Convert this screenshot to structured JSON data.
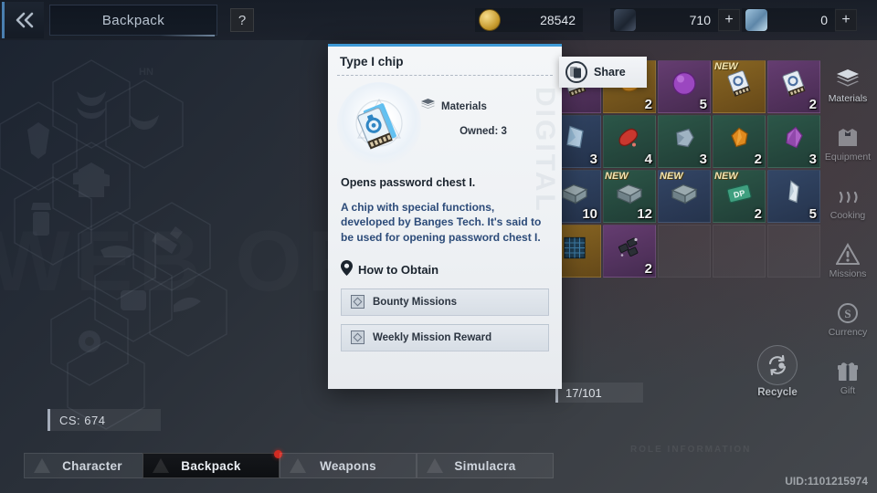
{
  "topbar": {
    "back_icon": "double-chevron-left-icon",
    "title": "Backpack",
    "help_label": "?",
    "currencies": [
      {
        "icon": "gold-coin-icon",
        "value": "28542",
        "has_plus": false,
        "plus_label": "+"
      },
      {
        "icon": "dark-crystal-icon",
        "value": "710",
        "has_plus": true,
        "plus_label": "+"
      },
      {
        "icon": "blue-crystal-icon",
        "value": "0",
        "has_plus": true,
        "plus_label": "+"
      }
    ]
  },
  "character_panel": {
    "watermark": "WEB OF",
    "cs_label": "CS:  674"
  },
  "share": {
    "icon": "share-icon",
    "label": "Share"
  },
  "dialog": {
    "title": "Type I chip",
    "category_icon": "layers-icon",
    "category": "Materials",
    "owned": "Owned: 3",
    "item_icon": "chip-card-icon",
    "effect": "Opens password chest I.",
    "description": "A chip with special functions, developed by Banges Tech. It's said to be used for opening password chest I.",
    "obtain_icon": "map-pin-icon",
    "obtain_title": "How to Obtain",
    "obtain_sources": [
      {
        "icon": "mission-scroll-icon",
        "label": "Bounty Missions"
      },
      {
        "icon": "mission-scroll-icon",
        "label": "Weekly Mission Reward"
      }
    ],
    "watermark": "DIGITAL"
  },
  "inventory": {
    "page_counter": "17/101",
    "cells": [
      {
        "row": 0,
        "col": 0,
        "rarity": "purple",
        "count": "",
        "new": false,
        "glyph": "chip-card-icon"
      },
      {
        "row": 0,
        "col": 1,
        "rarity": "gold",
        "count": "2",
        "new": false,
        "glyph": "amber-lump-icon"
      },
      {
        "row": 0,
        "col": 2,
        "rarity": "purple",
        "count": "5",
        "new": false,
        "glyph": "purple-orb-icon"
      },
      {
        "row": 0,
        "col": 3,
        "rarity": "gold",
        "count": "",
        "new": true,
        "glyph": "chip-card-icon"
      },
      {
        "row": 0,
        "col": 4,
        "rarity": "purple",
        "count": "2",
        "new": false,
        "glyph": "chip-card-icon"
      },
      {
        "row": 1,
        "col": 0,
        "rarity": "blue",
        "count": "3",
        "new": false,
        "glyph": "blue-shard-icon"
      },
      {
        "row": 1,
        "col": 1,
        "rarity": "green",
        "count": "4",
        "new": false,
        "glyph": "red-gem-icon"
      },
      {
        "row": 1,
        "col": 2,
        "rarity": "green",
        "count": "3",
        "new": false,
        "glyph": "grey-stone-icon"
      },
      {
        "row": 1,
        "col": 3,
        "rarity": "green",
        "count": "2",
        "new": false,
        "glyph": "orange-gem-icon"
      },
      {
        "row": 1,
        "col": 4,
        "rarity": "green",
        "count": "3",
        "new": false,
        "glyph": "violet-gem-icon"
      },
      {
        "row": 2,
        "col": 0,
        "rarity": "blue",
        "count": "10",
        "new": false,
        "glyph": "crate-icon"
      },
      {
        "row": 2,
        "col": 1,
        "rarity": "green",
        "count": "12",
        "new": true,
        "glyph": "crate-icon"
      },
      {
        "row": 2,
        "col": 2,
        "rarity": "blue",
        "count": "",
        "new": true,
        "glyph": "crate-icon"
      },
      {
        "row": 2,
        "col": 3,
        "rarity": "green",
        "count": "2",
        "new": true,
        "glyph": "dp-card-icon"
      },
      {
        "row": 2,
        "col": 4,
        "rarity": "blue",
        "count": "5",
        "new": false,
        "glyph": "white-crystal-icon"
      },
      {
        "row": 3,
        "col": 0,
        "rarity": "gold",
        "count": "",
        "new": false,
        "glyph": "grid-cube-icon"
      },
      {
        "row": 3,
        "col": 1,
        "rarity": "purple",
        "count": "2",
        "new": false,
        "glyph": "black-chips-icon"
      },
      {
        "row": 3,
        "col": 2,
        "rarity": "empty",
        "count": "",
        "new": false,
        "glyph": ""
      },
      {
        "row": 3,
        "col": 3,
        "rarity": "empty",
        "count": "",
        "new": false,
        "glyph": ""
      },
      {
        "row": 3,
        "col": 4,
        "rarity": "empty",
        "count": "",
        "new": false,
        "glyph": ""
      }
    ]
  },
  "sidebar": {
    "items": [
      {
        "icon": "layers-icon",
        "label": "Materials",
        "active": true
      },
      {
        "icon": "armor-icon",
        "label": "Equipment",
        "active": false
      },
      {
        "icon": "cooking-icon",
        "label": "Cooking",
        "active": false
      },
      {
        "icon": "mission-icon",
        "label": "Missions",
        "active": false
      },
      {
        "icon": "currency-icon",
        "label": "Currency",
        "active": false
      },
      {
        "icon": "gift-icon",
        "label": "Gift",
        "active": false
      }
    ]
  },
  "recycle": {
    "icon": "recycle-icon",
    "label": "Recycle"
  },
  "footer": {
    "role_info_watermark": "ROLE INFORMATION",
    "uid": "UID:1101215974",
    "tabs": [
      {
        "label": "Character",
        "active": false,
        "badge": false
      },
      {
        "label": "Backpack",
        "active": true,
        "badge": true
      },
      {
        "label": "Weapons",
        "active": false,
        "badge": false
      },
      {
        "label": "Simulacra",
        "active": false,
        "badge": false
      }
    ]
  }
}
